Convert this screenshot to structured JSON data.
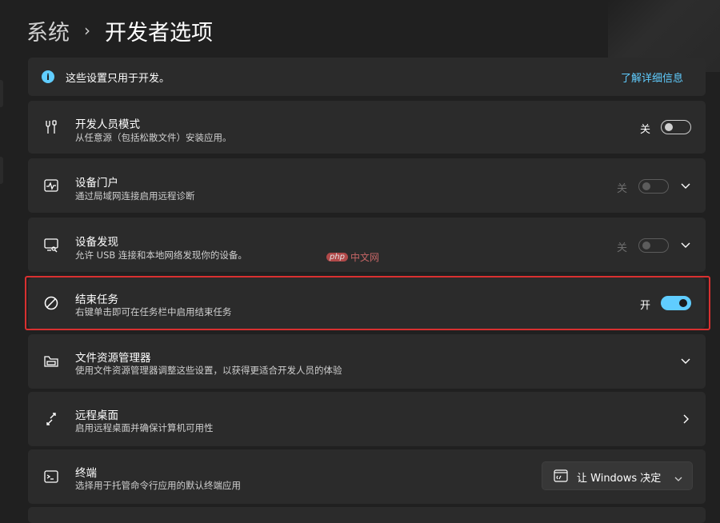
{
  "header": {
    "parent": "系统",
    "separator": "›",
    "current": "开发者选项"
  },
  "info": {
    "text": "这些设置只用于开发。",
    "link": "了解详细信息",
    "icon": "info-icon"
  },
  "rows": [
    {
      "key": "developer-mode",
      "icon": "developer-tools-icon",
      "title": "开发人员模式",
      "desc": "从任意源（包括松散文件）安装应用。",
      "state_label": "关",
      "toggle_state": "off",
      "expandable": false
    },
    {
      "key": "device-portal",
      "icon": "device-portal-icon",
      "title": "设备门户",
      "desc": "通过局域网连接启用远程诊断",
      "state_label": "关",
      "toggle_state": "disabled",
      "expandable": true
    },
    {
      "key": "device-discovery",
      "icon": "device-discovery-icon",
      "title": "设备发现",
      "desc": "允许 USB 连接和本地网络发现你的设备。",
      "state_label": "关",
      "toggle_state": "disabled",
      "expandable": true
    },
    {
      "key": "end-task",
      "icon": "end-task-icon",
      "title": "结束任务",
      "desc": "右键单击即可在任务栏中启用结束任务",
      "state_label": "开",
      "toggle_state": "on",
      "expandable": false,
      "highlighted": true
    },
    {
      "key": "file-explorer",
      "icon": "file-explorer-icon",
      "title": "文件资源管理器",
      "desc": "使用文件资源管理器调整这些设置，以获得更适合开发人员的体验",
      "expandable": true
    },
    {
      "key": "remote-desktop",
      "icon": "remote-desktop-icon",
      "title": "远程桌面",
      "desc": "启用远程桌面并确保计算机可用性",
      "navigates": true
    },
    {
      "key": "terminal",
      "icon": "terminal-icon",
      "title": "终端",
      "desc": "选择用于托管命令行应用的默认终端应用",
      "dropdown": {
        "icon": "terminal-app-icon",
        "value": "让 Windows 决定"
      }
    }
  ],
  "watermark": {
    "badge": "php",
    "text": "中文网"
  },
  "colors": {
    "background": "#202020",
    "card": "#2b2b2b",
    "accent": "#60cdff",
    "highlight_border": "#d93030"
  }
}
